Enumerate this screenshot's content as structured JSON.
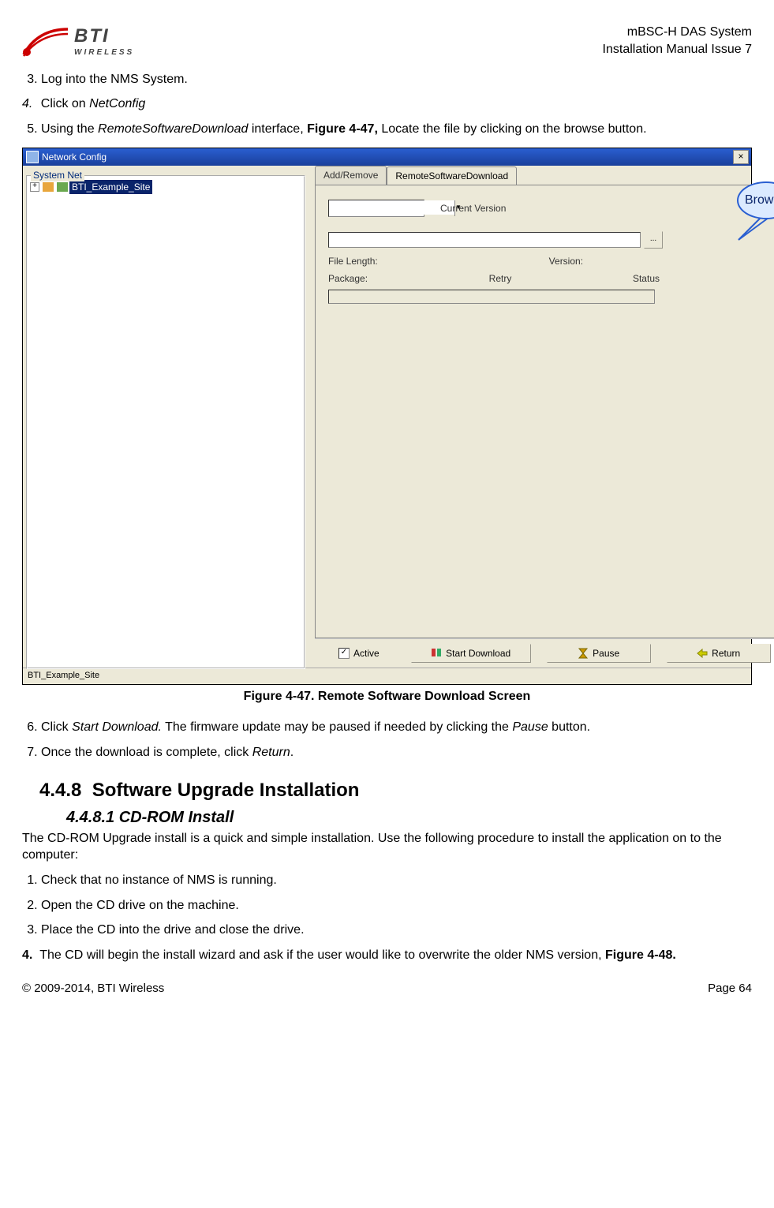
{
  "header": {
    "logo_text_top": "BTI",
    "logo_text_bottom": "WIRELESS",
    "doc_line1": "mBSC-H DAS System",
    "doc_line2": "Installation Manual Issue 7"
  },
  "steps_a": {
    "s3": "Log into the NMS System.",
    "s4_num": "4.",
    "s4_a": "Click on ",
    "s4_b": "NetConfig",
    "s5_a": "Using the ",
    "s5_b": "RemoteSoftwareDownload",
    "s5_c": " interface, ",
    "s5_d": "Figure 4-47,",
    "s5_e": " Locate the file by clicking on the browse button."
  },
  "window": {
    "title": "Network Config",
    "close": "×",
    "tree_group": "System Net",
    "tree_node": "BTI_Example_Site",
    "tab1": "Add/Remove",
    "tab2": "RemoteSoftwareDownload",
    "current_version": "Current Version",
    "browse_label": "Browse",
    "browse_btn": "...",
    "file_length": "File Length:",
    "version": "Version:",
    "package": "Package:",
    "retry": "Retry",
    "status": "Status",
    "active": "Active",
    "active_check": "✓",
    "start_download": "Start Download",
    "pause": "Pause",
    "return": "Return",
    "status_text": "BTI_Example_Site"
  },
  "caption": "Figure 4-47. Remote Software Download Screen",
  "steps_b": {
    "s6_a": "Click ",
    "s6_b": "Start Download.",
    "s6_c": " The firmware update may be paused if needed by clicking the ",
    "s6_d": "Pause",
    "s6_e": " button.",
    "s7_a": "Once the download is complete, click ",
    "s7_b": "Return",
    "s7_c": "."
  },
  "section": {
    "num": "4.4.8",
    "title": "Software Upgrade Installation",
    "sub_num": "4.4.8.1",
    "sub_title": "CD-ROM Install",
    "intro": "The CD-ROM Upgrade install is a quick and simple installation. Use the following procedure to install the application on to the computer:"
  },
  "steps_c": {
    "s1": "Check that no instance of NMS is running.",
    "s2": "Open the CD drive on the machine.",
    "s3": "Place the CD into the drive and close the drive.",
    "s4_a": "The CD will begin the install wizard and ask if the user would like to overwrite the older NMS version, ",
    "s4_b": "Figure 4-48."
  },
  "footer": {
    "left": "© 2009-2014, BTI Wireless",
    "right": "Page 64"
  }
}
